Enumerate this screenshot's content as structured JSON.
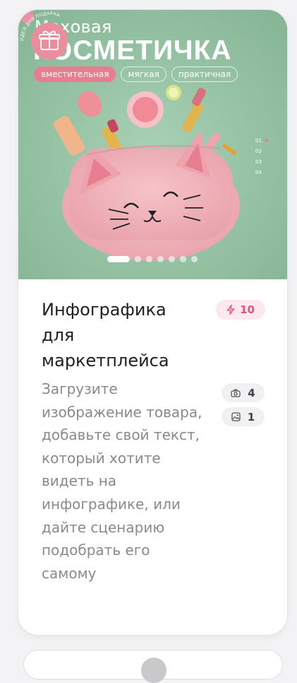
{
  "card": {
    "hero": {
      "title_line1": "Меховая",
      "title_line2": "КОСМЕТИЧКА",
      "tags": [
        "вместительная",
        "мягкая",
        "практичная"
      ],
      "steps": [
        "01",
        "02",
        "03",
        "04"
      ],
      "badge_text": "ИДЕЯ ДЛЯ ПОДАРКА",
      "slide_count": 7,
      "active_slide": 1
    },
    "title": "Инфографика для маркетплейса",
    "description": "Загрузите изображение товара, добавьте свой текст, который хотите видеть на инфографике, или дайте сценарию подобрать его самому",
    "credits": "10",
    "photo_count": "4",
    "image_count": "1"
  },
  "colors": {
    "accent_pink": "#e87d8f",
    "credit_text": "#e0557e",
    "hero_background": "#98c3a6"
  },
  "icons": [
    "heart-icon",
    "lightning-icon",
    "camera-icon",
    "image-icon",
    "gift-icon"
  ]
}
